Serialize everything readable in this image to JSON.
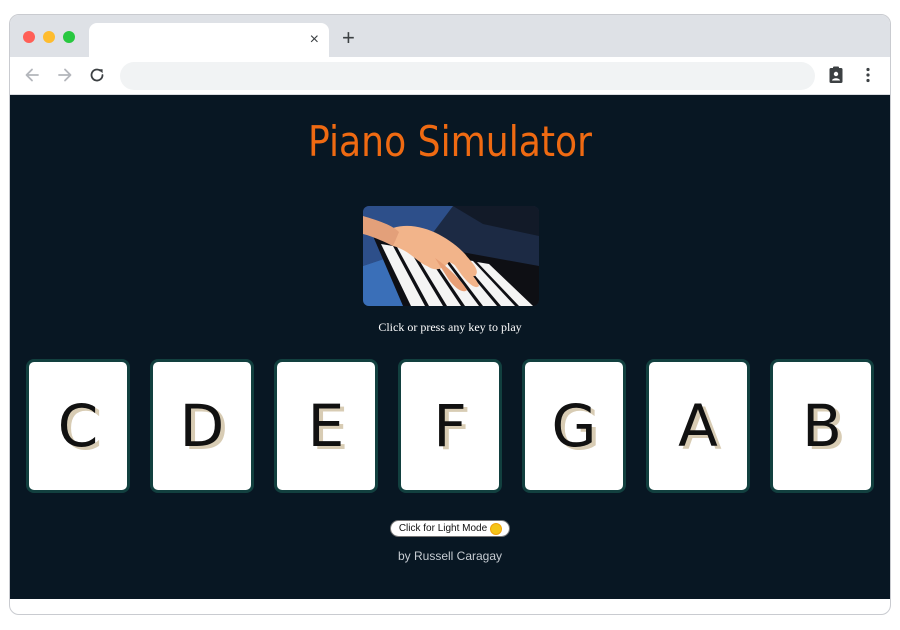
{
  "browser": {
    "tab_title": "",
    "tab_close": "×",
    "new_tab": "+",
    "address": ""
  },
  "page": {
    "title": "Piano Simulator",
    "instructions": "Click or press any key to play",
    "keys": [
      "C",
      "D",
      "E",
      "F",
      "G",
      "A",
      "B"
    ],
    "mode_button": "Click for Light Mode",
    "credit": "by Russell Caragay"
  },
  "colors": {
    "background": "#081723",
    "title": "#ef6a12",
    "key_border": "#12403f",
    "key_face": "#ffffff"
  },
  "icons": {
    "back": "arrow-left-icon",
    "forward": "arrow-right-icon",
    "reload": "reload-icon",
    "clipboard": "clipboard-account-icon",
    "menu": "vertical-dots-icon",
    "mode": "sun-icon"
  }
}
